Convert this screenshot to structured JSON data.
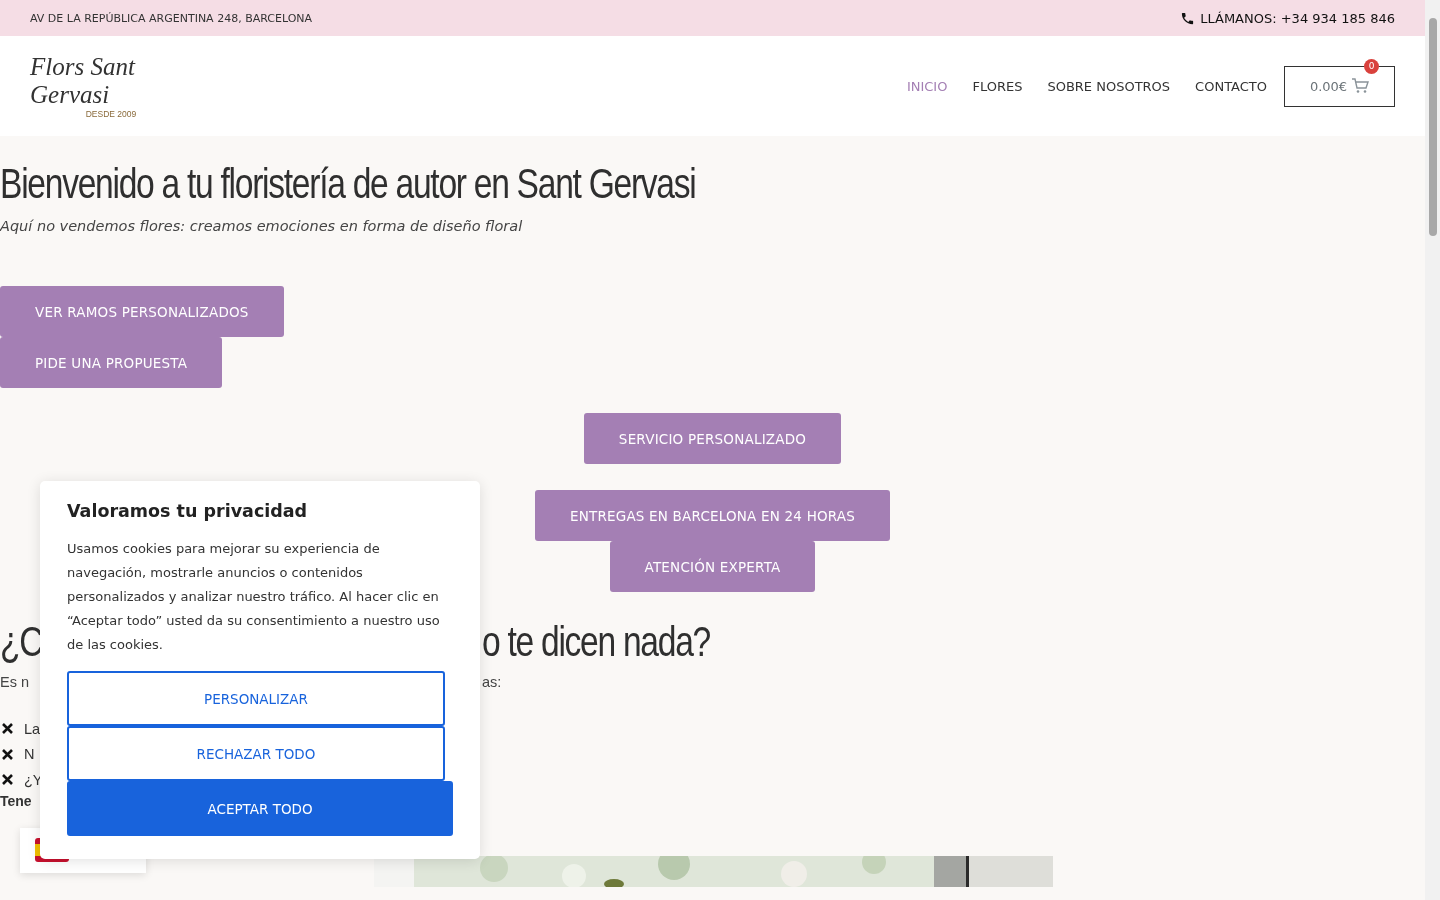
{
  "top_bar": {
    "address": "AV DE LA REPÚBLICA ARGENTINA 248, BARCELONA",
    "phone": "LLÁMANOS: +34 934 185 846"
  },
  "header": {
    "logo_name": "Flors Sant Gervasi",
    "logo_tagline": "DESDE 2009",
    "nav": [
      {
        "label": "INICIO",
        "selected": true
      },
      {
        "label": "FLORES",
        "selected": false
      },
      {
        "label": "SOBRE NOSOTROS",
        "selected": false
      },
      {
        "label": "CONTACTO",
        "selected": false
      }
    ],
    "cart": {
      "total": "0.00€",
      "count": "0"
    }
  },
  "hero": {
    "title": "Bienvenido a tu floristería de autor en Sant Gervasi",
    "subtitle": "Aquí no vendemos flores: creamos emociones en forma de diseño floral",
    "buttons": [
      "VER RAMOS PERSONALIZADOS",
      "PIDE UNA PROPUESTA"
    ],
    "features": [
      "SERVICIO PERSONALIZADO",
      "ENTREGAS EN BARCELONA EN 24 HORAS",
      "ATENCIÓN EXPERTA"
    ]
  },
  "section": {
    "title_fragments": [
      "¿C",
      "o te dicen nada?"
    ],
    "intro_fragments": [
      "Es n",
      "as:"
    ],
    "list": [
      "La",
      "N",
      "¿Y"
    ],
    "note": "Tene"
  },
  "cookie_banner": {
    "title": "Valoramos tu privacidad",
    "text": "Usamos cookies para mejorar su experiencia de navegación, mostrarle anuncios o contenidos personalizados y analizar nuestro tráfico. Al hacer clic en “Aceptar todo” usted da su consentimiento a nuestro uso de las cookies.",
    "buttons": [
      {
        "label": "PERSONALIZAR",
        "kind": "outline"
      },
      {
        "label": "RECHAZAR TODO",
        "kind": "outline"
      },
      {
        "label": "ACEPTAR TODO",
        "kind": "primary"
      }
    ]
  }
}
